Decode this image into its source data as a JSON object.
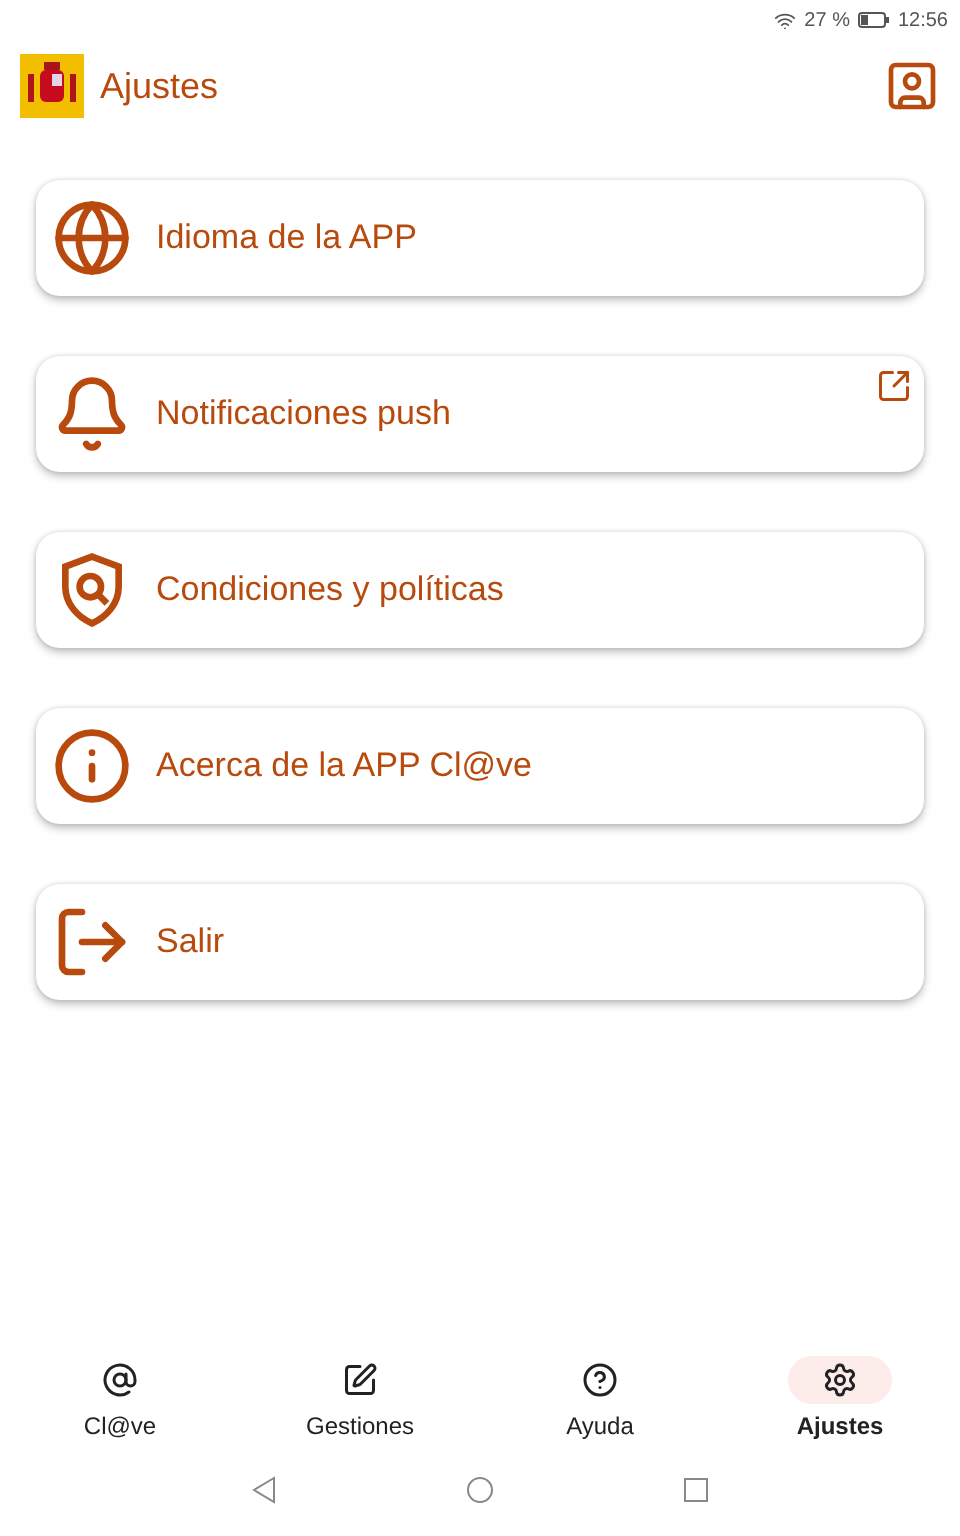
{
  "status_bar": {
    "battery": "27 %",
    "time": "12:56"
  },
  "header": {
    "title": "Ajustes"
  },
  "items": [
    {
      "kind": "language",
      "label": "Idioma de la APP",
      "external": false
    },
    {
      "kind": "notifications",
      "label": "Notificaciones push",
      "external": true
    },
    {
      "kind": "policies",
      "label": "Condiciones y políticas",
      "external": false
    },
    {
      "kind": "about",
      "label": "Acerca de la APP Cl@ve",
      "external": false
    },
    {
      "kind": "exit",
      "label": "Salir",
      "external": false
    }
  ],
  "bottom_nav": [
    {
      "kind": "clave",
      "label": "Cl@ve",
      "selected": false
    },
    {
      "kind": "gestiones",
      "label": "Gestiones",
      "selected": false
    },
    {
      "kind": "help",
      "label": "Ayuda",
      "selected": false
    },
    {
      "kind": "settings",
      "label": "Ajustes",
      "selected": true
    }
  ]
}
